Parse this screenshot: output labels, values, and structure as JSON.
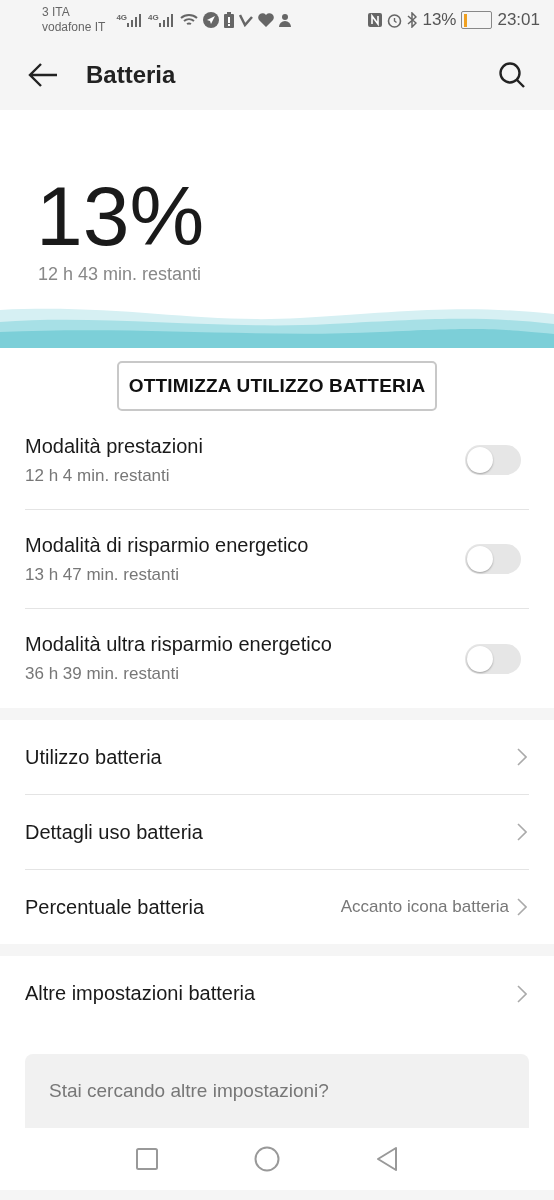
{
  "status_bar": {
    "carrier_1": "3 ITA",
    "carrier_2": "vodafone IT",
    "network_1": "4G",
    "network_2": "4G",
    "battery_text": "13%",
    "time": "23:01"
  },
  "header": {
    "title": "Batteria"
  },
  "hero": {
    "percent": "13%",
    "remaining": "12 h 43 min. restanti"
  },
  "optimize_button": "OTTIMIZZA UTILIZZO BATTERIA",
  "modes": [
    {
      "title": "Modalità prestazioni",
      "subtitle": "12 h 4 min. restanti",
      "on": false
    },
    {
      "title": "Modalità di risparmio energetico",
      "subtitle": "13 h 47 min. restanti",
      "on": false
    },
    {
      "title": "Modalità ultra risparmio energetico",
      "subtitle": "36 h 39 min. restanti",
      "on": false
    }
  ],
  "links": [
    {
      "title": "Utilizzo batteria"
    },
    {
      "title": "Dettagli uso batteria"
    },
    {
      "title": "Percentuale batteria",
      "value": "Accanto icona batteria"
    }
  ],
  "more_links": [
    {
      "title": "Altre impostazioni batteria"
    }
  ],
  "suggestion": {
    "title": "Stai cercando altre impostazioni?"
  }
}
